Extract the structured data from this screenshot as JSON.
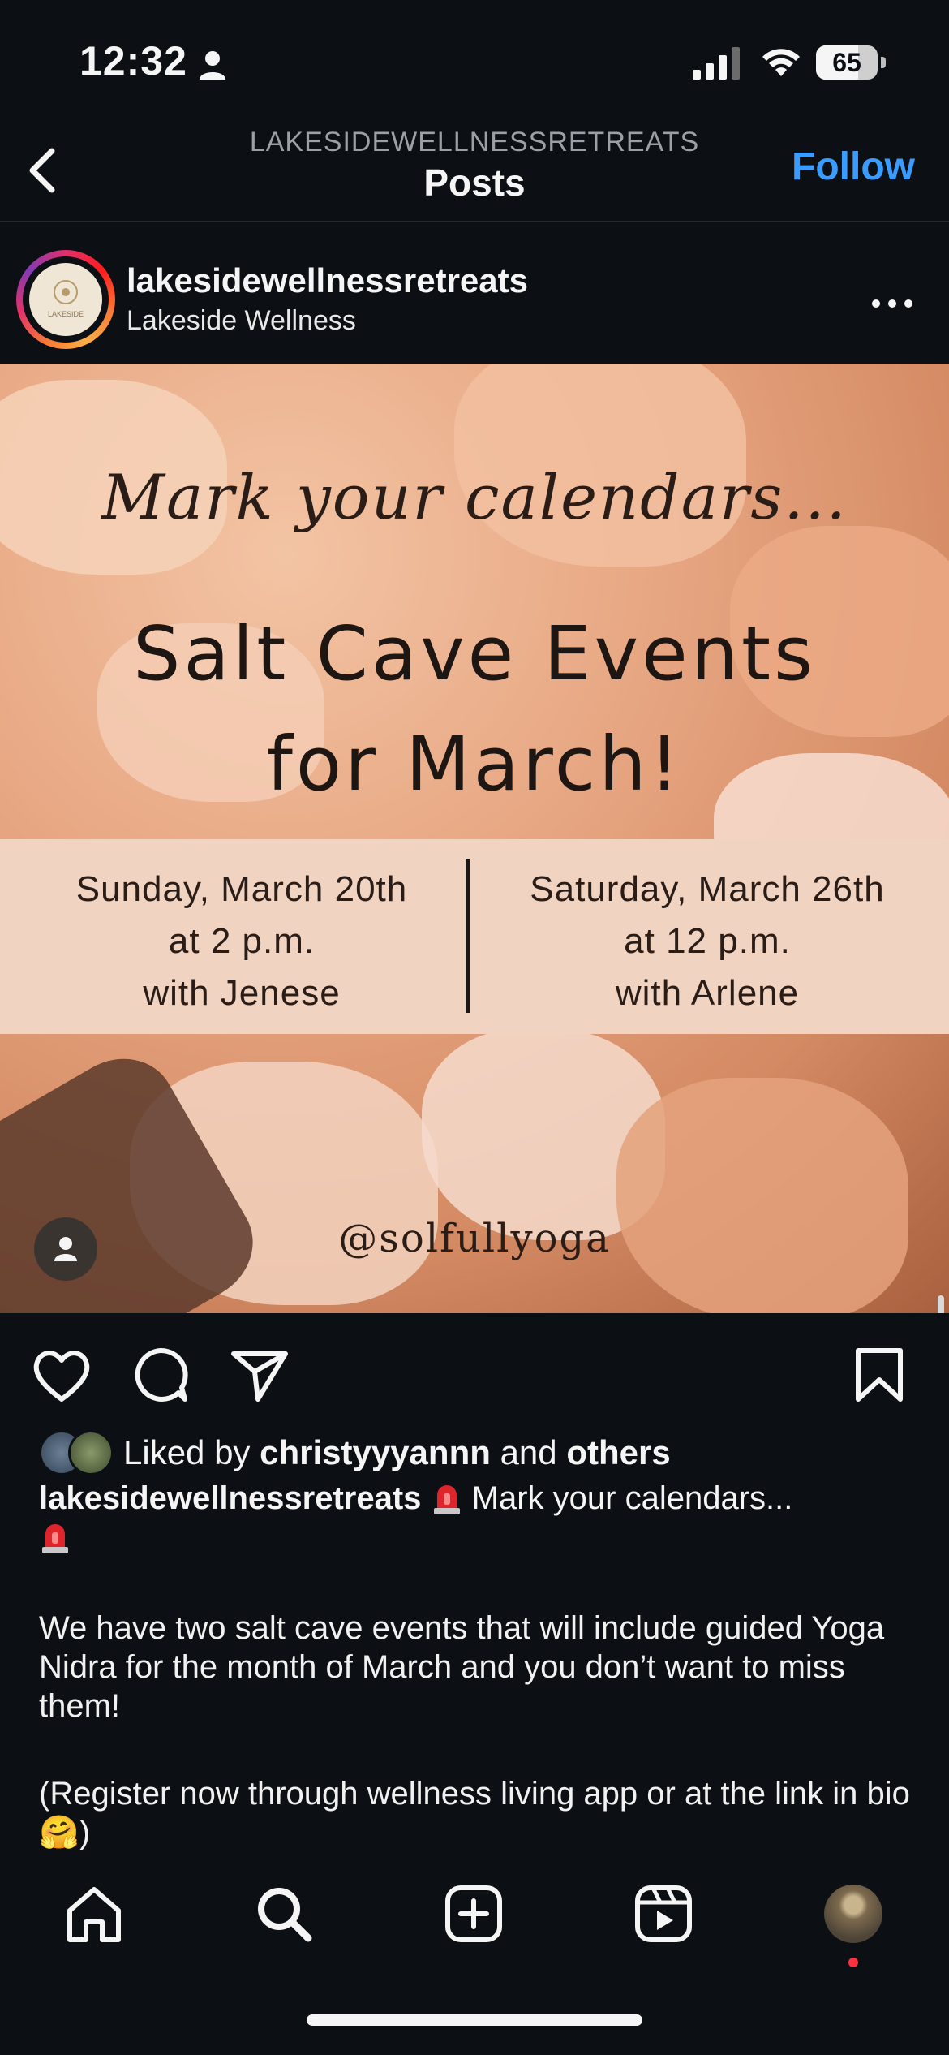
{
  "status_bar": {
    "time": "12:32",
    "battery": "65"
  },
  "header": {
    "account_label": "LAKESIDEWELLNESSRETREATS",
    "title": "Posts",
    "follow_label": "Follow"
  },
  "post": {
    "username": "lakesidewellnessretreats",
    "subtitle": "Lakeside Wellness",
    "avatar_text": "LAKESIDE",
    "image": {
      "script_line": "Mark your calendars...",
      "headline_1": "Salt Cave Events",
      "headline_2": "for March!",
      "event_left": {
        "line1": "Sunday, March 20th",
        "line2": "at 2 p.m.",
        "line3": "with Jenese"
      },
      "event_right": {
        "line1": "Saturday, March 26th",
        "line2": "at 12 p.m.",
        "line3": "with Arlene"
      },
      "handle": "@solfullyoga"
    },
    "likes": {
      "prefix": "Liked by",
      "user": "christyyyannn",
      "middle": "and",
      "others": "others"
    },
    "caption": {
      "user": "lakesidewellnessretreats",
      "first_line": "Mark your calendars...",
      "paragraph_1": "We have two salt cave events that will include guided Yoga Nidra for the month of March and you don’t want to miss them!",
      "paragraph_2": "(Register now through wellness living app or at the link in bio🤗)"
    }
  },
  "colors": {
    "accent": "#3b9cff",
    "background": "#0c1014",
    "notification": "#ff3040"
  }
}
